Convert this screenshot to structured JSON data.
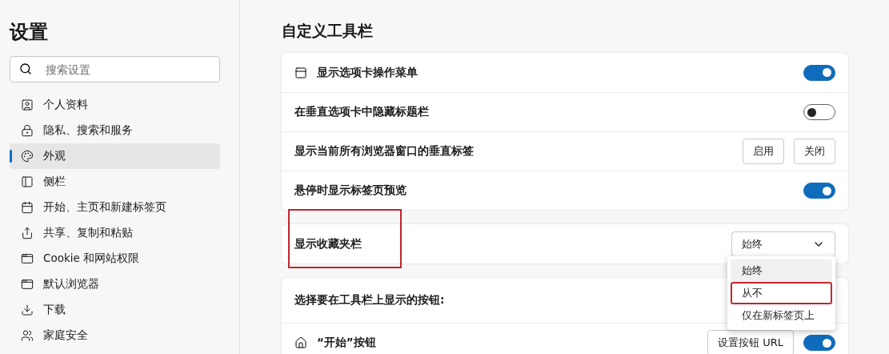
{
  "sidebar": {
    "title": "设置",
    "search": {
      "placeholder": "搜索设置"
    },
    "items": [
      {
        "label": "个人资料",
        "selected": false
      },
      {
        "label": "隐私、搜索和服务",
        "selected": false
      },
      {
        "label": "外观",
        "selected": true
      },
      {
        "label": "侧栏",
        "selected": false
      },
      {
        "label": "开始、主页和新建标签页",
        "selected": false
      },
      {
        "label": "共享、复制和粘贴",
        "selected": false
      },
      {
        "label": "Cookie 和网站权限",
        "selected": false
      },
      {
        "label": "默认浏览器",
        "selected": false
      },
      {
        "label": "下载",
        "selected": false
      },
      {
        "label": "家庭安全",
        "selected": false
      }
    ]
  },
  "main": {
    "title": "自定义工具栏",
    "card_1": [
      {
        "kind": "toggle",
        "icon": true,
        "label": "显示选项卡操作菜单",
        "on": true
      },
      {
        "kind": "toggle",
        "label": "在垂直选项卡中隐藏标题栏",
        "on": false
      },
      {
        "kind": "buttons",
        "label": "显示当前所有浏览器窗口的垂直标签",
        "buttons": [
          "启用",
          "关闭"
        ]
      },
      {
        "kind": "toggle",
        "label": "悬停时显示标签页预览",
        "on": true
      }
    ],
    "favorites_bar": {
      "label": "显示收藏夹栏",
      "highlighted": true,
      "value": "始终",
      "expanded": true,
      "options": [
        {
          "label": "始终",
          "selected": true,
          "highlighted": false
        },
        {
          "label": "从不",
          "selected": false,
          "highlighted": true
        },
        {
          "label": "仅在新标签页上",
          "selected": false,
          "highlighted": false
        }
      ]
    },
    "card_3": {
      "heading": "选择要在工具栏上显示的按钮:",
      "rows": [
        {
          "label": "“开始”按钮",
          "button": "设置按钮 URL",
          "on": true
        }
      ]
    }
  }
}
